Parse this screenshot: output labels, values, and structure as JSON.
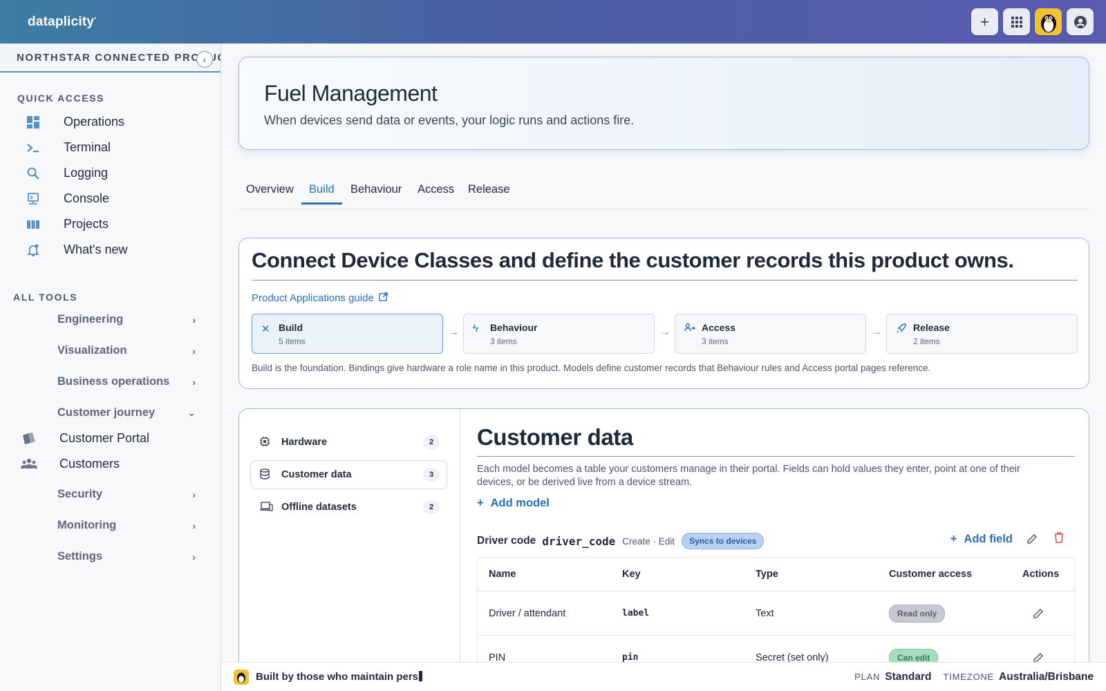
{
  "brand": {
    "name": "dataplicity",
    "mark": "•"
  },
  "topbar": {
    "add_icon": "plus-icon",
    "apps_icon": "grid-icon",
    "avatar_icon": "penguin-avatar",
    "account_icon": "account-circle-icon"
  },
  "sidebar": {
    "org_name": "NORTHSTAR CONNECTED PRODUCT",
    "quick_access_label": "QUICK ACCESS",
    "quick_access": [
      {
        "label": "Operations",
        "icon": "dashboard-icon"
      },
      {
        "label": "Terminal",
        "icon": "terminal-icon"
      },
      {
        "label": "Logging",
        "icon": "search-icon"
      },
      {
        "label": "Console",
        "icon": "console-icon"
      },
      {
        "label": "Projects",
        "icon": "columns-icon"
      },
      {
        "label": "What's new",
        "icon": "bell-icon"
      }
    ],
    "all_tools_label": "ALL TOOLS",
    "groups": [
      {
        "label": "Engineering"
      },
      {
        "label": "Visualization"
      },
      {
        "label": "Business operations"
      },
      {
        "label": "Customer journey"
      },
      {
        "label": "Security"
      },
      {
        "label": "Monitoring"
      },
      {
        "label": "Settings"
      }
    ],
    "customer_journey_items": [
      {
        "label": "Customer Portal",
        "icon": "portal-icon"
      },
      {
        "label": "Customers",
        "icon": "users-icon"
      }
    ]
  },
  "hero": {
    "title": "Fuel Management",
    "subtitle": "When devices send data or events, your logic runs and actions fire."
  },
  "tabs": [
    {
      "label": "Overview"
    },
    {
      "label": "Build",
      "active": true
    },
    {
      "label": "Behaviour"
    },
    {
      "label": "Access"
    },
    {
      "label": "Release"
    }
  ],
  "guide": {
    "title": "Connect Device Classes and define the customer records this product owns.",
    "link": "Product Applications guide",
    "steps": [
      {
        "name": "Build",
        "count": "5 items",
        "icon": "tools-icon"
      },
      {
        "name": "Behaviour",
        "count": "3 items",
        "icon": "bolt-icon"
      },
      {
        "name": "Access",
        "count": "3 items",
        "icon": "people-icon"
      },
      {
        "name": "Release",
        "count": "2 items",
        "icon": "rocket-icon"
      }
    ],
    "note": "Build is the foundation. Bindings give hardware a role name in this product. Models define customer records that Behaviour rules and Access portal pages reference."
  },
  "panel_nav": [
    {
      "label": "Hardware",
      "count": "2",
      "icon": "chip-icon"
    },
    {
      "label": "Customer data",
      "count": "3",
      "icon": "database-icon"
    },
    {
      "label": "Offline datasets",
      "count": "2",
      "icon": "devices-icon"
    }
  ],
  "customer_data": {
    "title": "Customer data",
    "description": "Each model becomes a table your customers manage in their portal. Fields can hold values they enter, point at one of their devices, or be derived live from a device stream.",
    "add_model": "Add model",
    "model": {
      "name": "Driver code",
      "key": "driver_code",
      "ops": "Create · Edit",
      "badge": "Syncs to devices",
      "add_field": "Add field"
    },
    "table": {
      "headers": [
        "Name",
        "Key",
        "Type",
        "Customer access",
        "Actions"
      ],
      "rows": [
        {
          "name": "Driver / attendant",
          "key": "label",
          "type": "Text",
          "access": "Read only"
        },
        {
          "name": "PIN",
          "key": "pin",
          "type": "Secret (set only)",
          "access": "Can edit"
        }
      ]
    }
  },
  "footer": {
    "tagline": "Built by those who maintain pers",
    "plan_label": "PLAN",
    "plan_value": "Standard",
    "timezone_label": "TIMEZONE",
    "timezone_value": "Australia/Brisbane"
  }
}
